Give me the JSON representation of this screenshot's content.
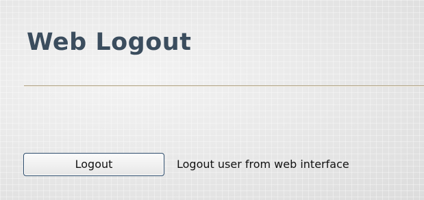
{
  "page": {
    "title": "Web Logout"
  },
  "logout": {
    "button_label": "Logout",
    "description": "Logout user from web interface"
  },
  "colors": {
    "title": "#3b4d5e",
    "divider": "#b1a487",
    "button_border": "#2b4a6a",
    "background": "#e6e6e6"
  }
}
